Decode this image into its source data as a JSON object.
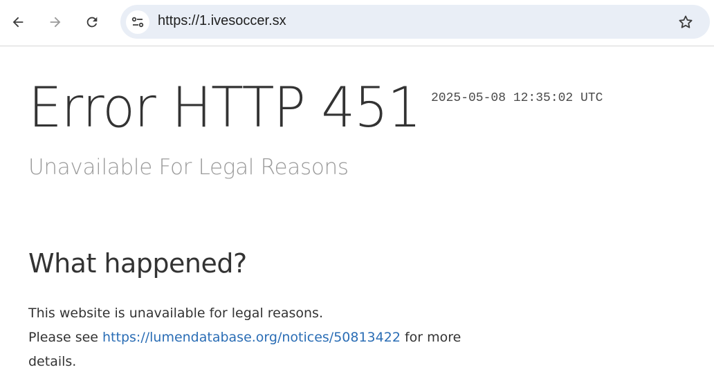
{
  "browser": {
    "url": "https://1.ivesoccer.sx",
    "back_icon": "arrow-left-icon",
    "forward_icon": "arrow-right-icon",
    "reload_icon": "reload-icon",
    "site_info_icon": "tune-icon",
    "bookmark_icon": "star-icon",
    "omnibox_color": "#e9eef6"
  },
  "page": {
    "title": "Error HTTP 451",
    "timestamp": "2025-05-08 12:35:02 UTC",
    "subtitle": "Unavailable For Legal Reasons",
    "section_heading": "What happened?",
    "line1": "This website is unavailable for legal reasons.",
    "line2_prefix": "Please see ",
    "link_text": "https://lumendatabase.org/notices/50813422",
    "line2_suffix": " for more details.",
    "link_color": "#2a6db5"
  }
}
